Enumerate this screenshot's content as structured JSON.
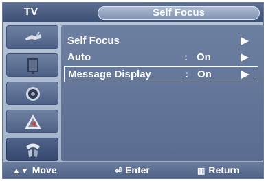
{
  "header": {
    "source_label": "TV",
    "title": "Self Focus"
  },
  "sidebar": {
    "items": [
      {
        "icon": "antenna-icon",
        "label": "Input"
      },
      {
        "icon": "picture-icon",
        "label": "Picture"
      },
      {
        "icon": "speaker-icon",
        "label": "Sound"
      },
      {
        "icon": "channel-icon",
        "label": "Channel"
      },
      {
        "icon": "setup-icon",
        "label": "Setup"
      }
    ]
  },
  "menu": {
    "rows": [
      {
        "label": "Self Focus",
        "colon": "",
        "value": "",
        "arrow": true,
        "selected": false
      },
      {
        "label": "Auto",
        "colon": ":",
        "value": "On",
        "arrow": true,
        "selected": false
      },
      {
        "label": "Message Display",
        "colon": ":",
        "value": "On",
        "arrow": true,
        "selected": true
      }
    ]
  },
  "footer": {
    "move": "Move",
    "enter": "Enter",
    "return": "Return"
  },
  "colors": {
    "accent": "#4d6086",
    "panel": "#6d7fa1",
    "text": "#ffffff"
  }
}
